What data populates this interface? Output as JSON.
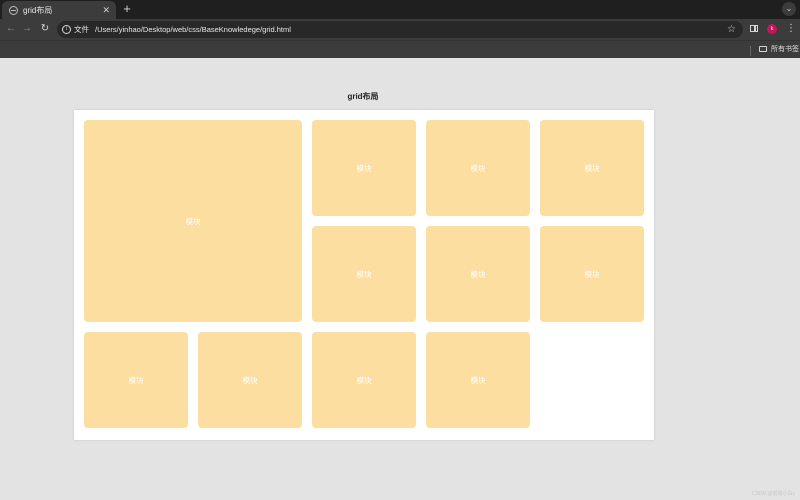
{
  "browser": {
    "tab": {
      "title": "grid布局"
    },
    "new_tab_label": "+",
    "tab_search_label": "⌄",
    "nav": {
      "back": "←",
      "forward": "→",
      "reload": "↻"
    },
    "omnibox": {
      "info_icon": "i",
      "site_chip": "文件",
      "url": "/Users/yinhao/Desktop/web/css/BaseKnowledege/grid.html"
    },
    "star_icon": "☆",
    "avatar_letter": "k",
    "menu_icon": "⋮",
    "bookmarks": {
      "all_bookmarks_label": "所有书签"
    }
  },
  "page": {
    "heading": "grid布局",
    "blocks": [
      {
        "label": "模块"
      },
      {
        "label": "模块"
      },
      {
        "label": "模块"
      },
      {
        "label": "模块"
      },
      {
        "label": "模块"
      },
      {
        "label": "模块"
      },
      {
        "label": "模块"
      },
      {
        "label": "模块"
      },
      {
        "label": "模块"
      },
      {
        "label": "模块"
      },
      {
        "label": "模块"
      }
    ],
    "block_color": "#fbdea0",
    "watermark": "CSDN @前端小白y"
  }
}
